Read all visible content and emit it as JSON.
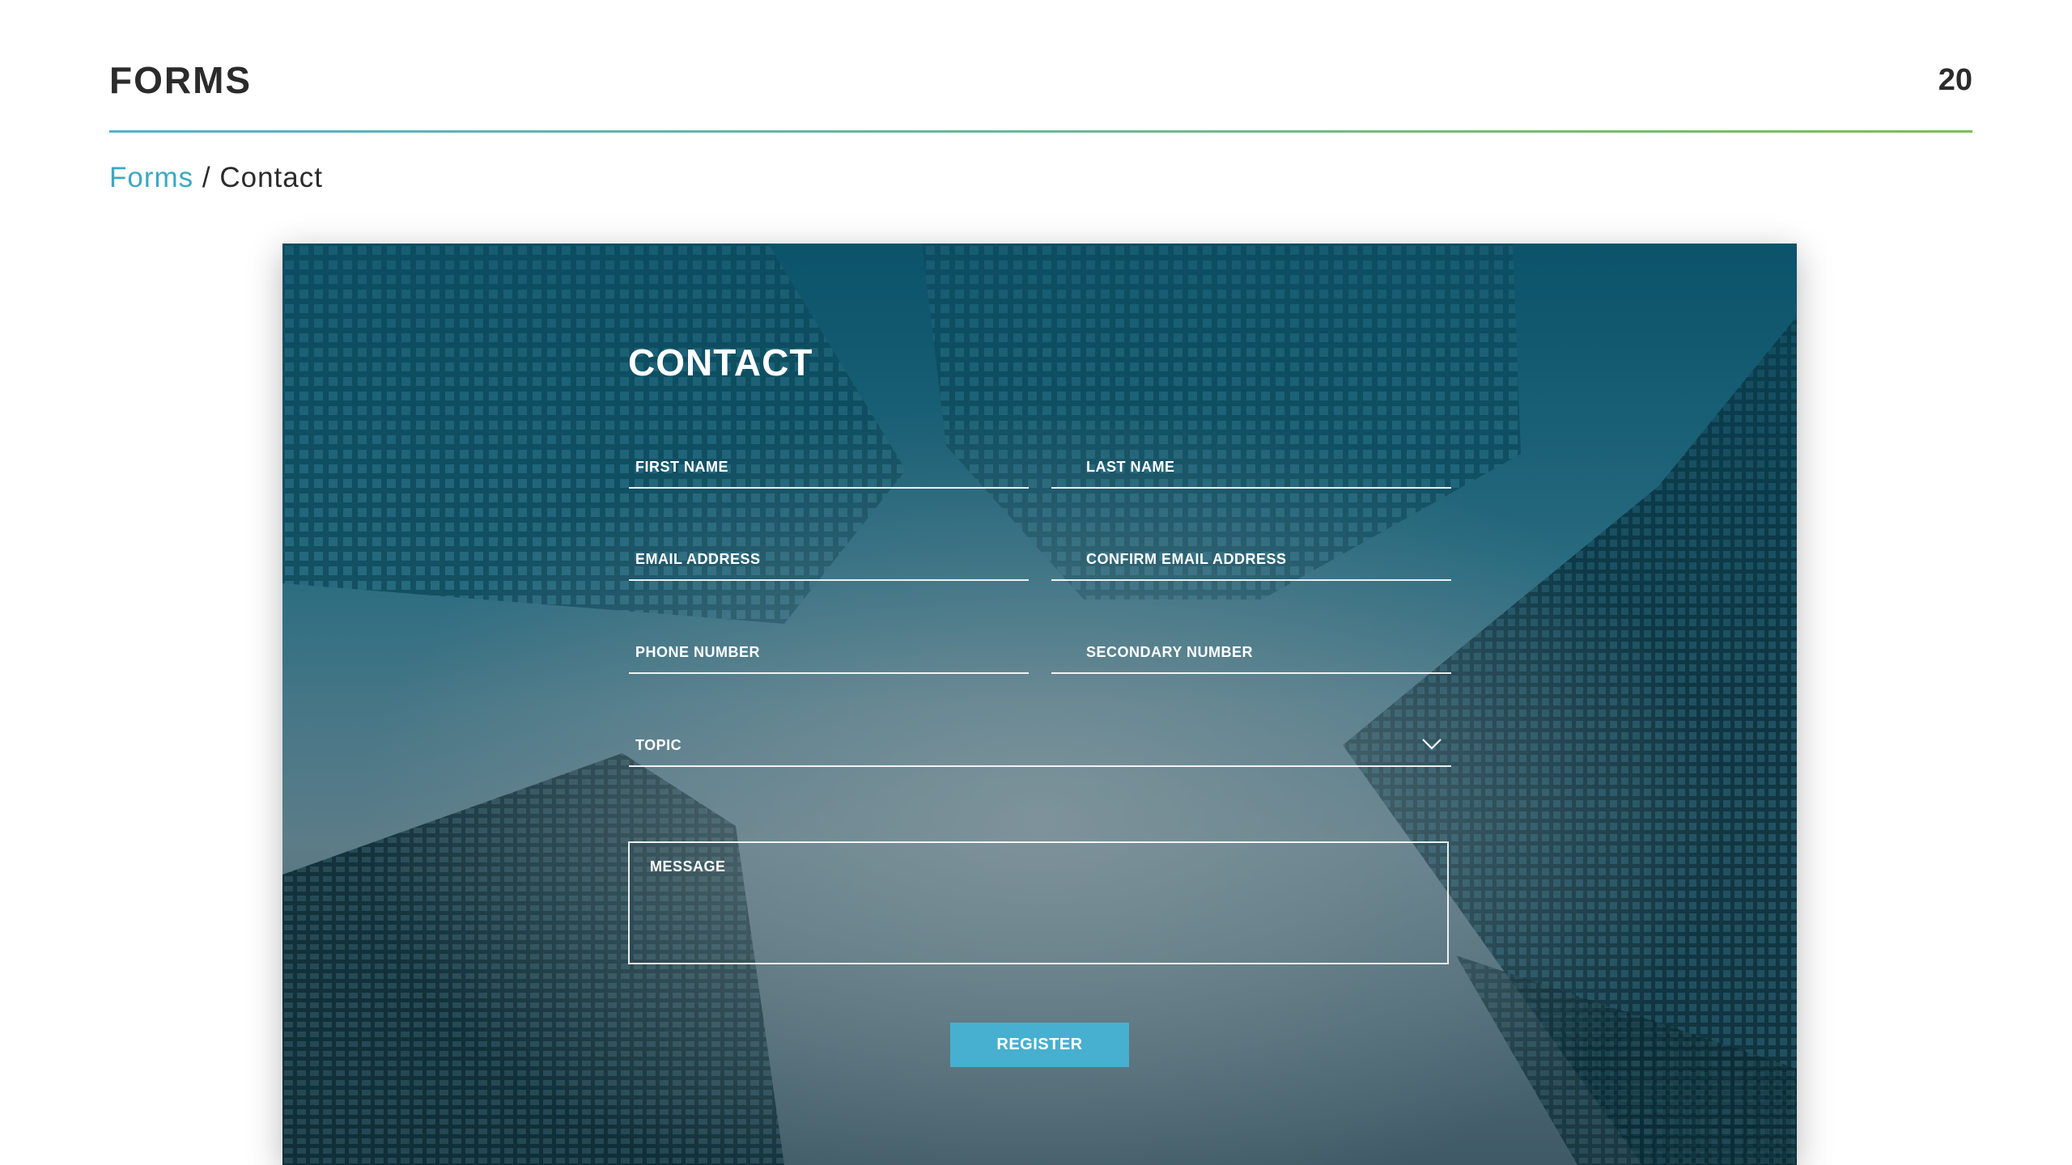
{
  "header": {
    "title": "FORMS",
    "page_number": "20"
  },
  "breadcrumb": {
    "parent": "Forms",
    "separator": " / ",
    "current": "Contact"
  },
  "form": {
    "title": "CONTACT",
    "fields": {
      "first_name": "FIRST NAME",
      "last_name": "LAST NAME",
      "email": "EMAIL ADDRESS",
      "confirm_email": "CONFIRM EMAIL ADDRESS",
      "phone": "PHONE NUMBER",
      "secondary_phone": "SECONDARY NUMBER",
      "topic": "TOPIC",
      "message": "MESSAGE"
    },
    "topic_icon": "chevron-down-icon",
    "submit_label": "REGISTER"
  },
  "colors": {
    "accent": "#47afd0",
    "link": "#3ba8c4",
    "rule_start": "#4fb3cf",
    "rule_end": "#7cbf4f"
  }
}
